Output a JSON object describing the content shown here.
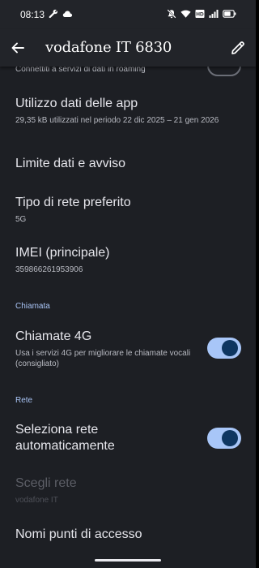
{
  "status_bar": {
    "time": "08:13",
    "left_icons": [
      "wrench-icon",
      "cloud-icon"
    ],
    "right_icons": [
      "mute-icon",
      "wifi-icon",
      "volte-icon",
      "signal-icon",
      "battery-icon"
    ]
  },
  "app_bar": {
    "title": "vodafone IT 6830"
  },
  "roaming": {
    "subtitle": "Connettiti a servizi di dati in roaming",
    "enabled": false
  },
  "app_data_usage": {
    "title": "Utilizzo dati delle app",
    "subtitle": "29,35 kB utilizzati nel periodo 22 dic 2025 – 21 gen 2026"
  },
  "data_limit": {
    "title": "Limite dati e avviso"
  },
  "preferred_network": {
    "title": "Tipo di rete preferito",
    "subtitle": "5G"
  },
  "imei": {
    "title": "IMEI (principale)",
    "subtitle": "359866261953906"
  },
  "calls_section": {
    "header": "Chiamata"
  },
  "calls_4g": {
    "title": "Chiamate 4G",
    "subtitle": "Usa i servizi 4G per migliorare le chiamate vocali (consigliato)",
    "enabled": true
  },
  "network_section": {
    "header": "Rete"
  },
  "auto_network": {
    "title": "Seleziona rete automaticamente",
    "enabled": true
  },
  "choose_network": {
    "title": "Scegli rete",
    "subtitle": "vodafone IT",
    "disabled": true
  },
  "apn": {
    "title": "Nomi punti di accesso"
  },
  "colors": {
    "background": "#1d1f24",
    "appbar": "#222429",
    "accent": "#a8c6f8",
    "section_header": "#a9c4f5"
  }
}
